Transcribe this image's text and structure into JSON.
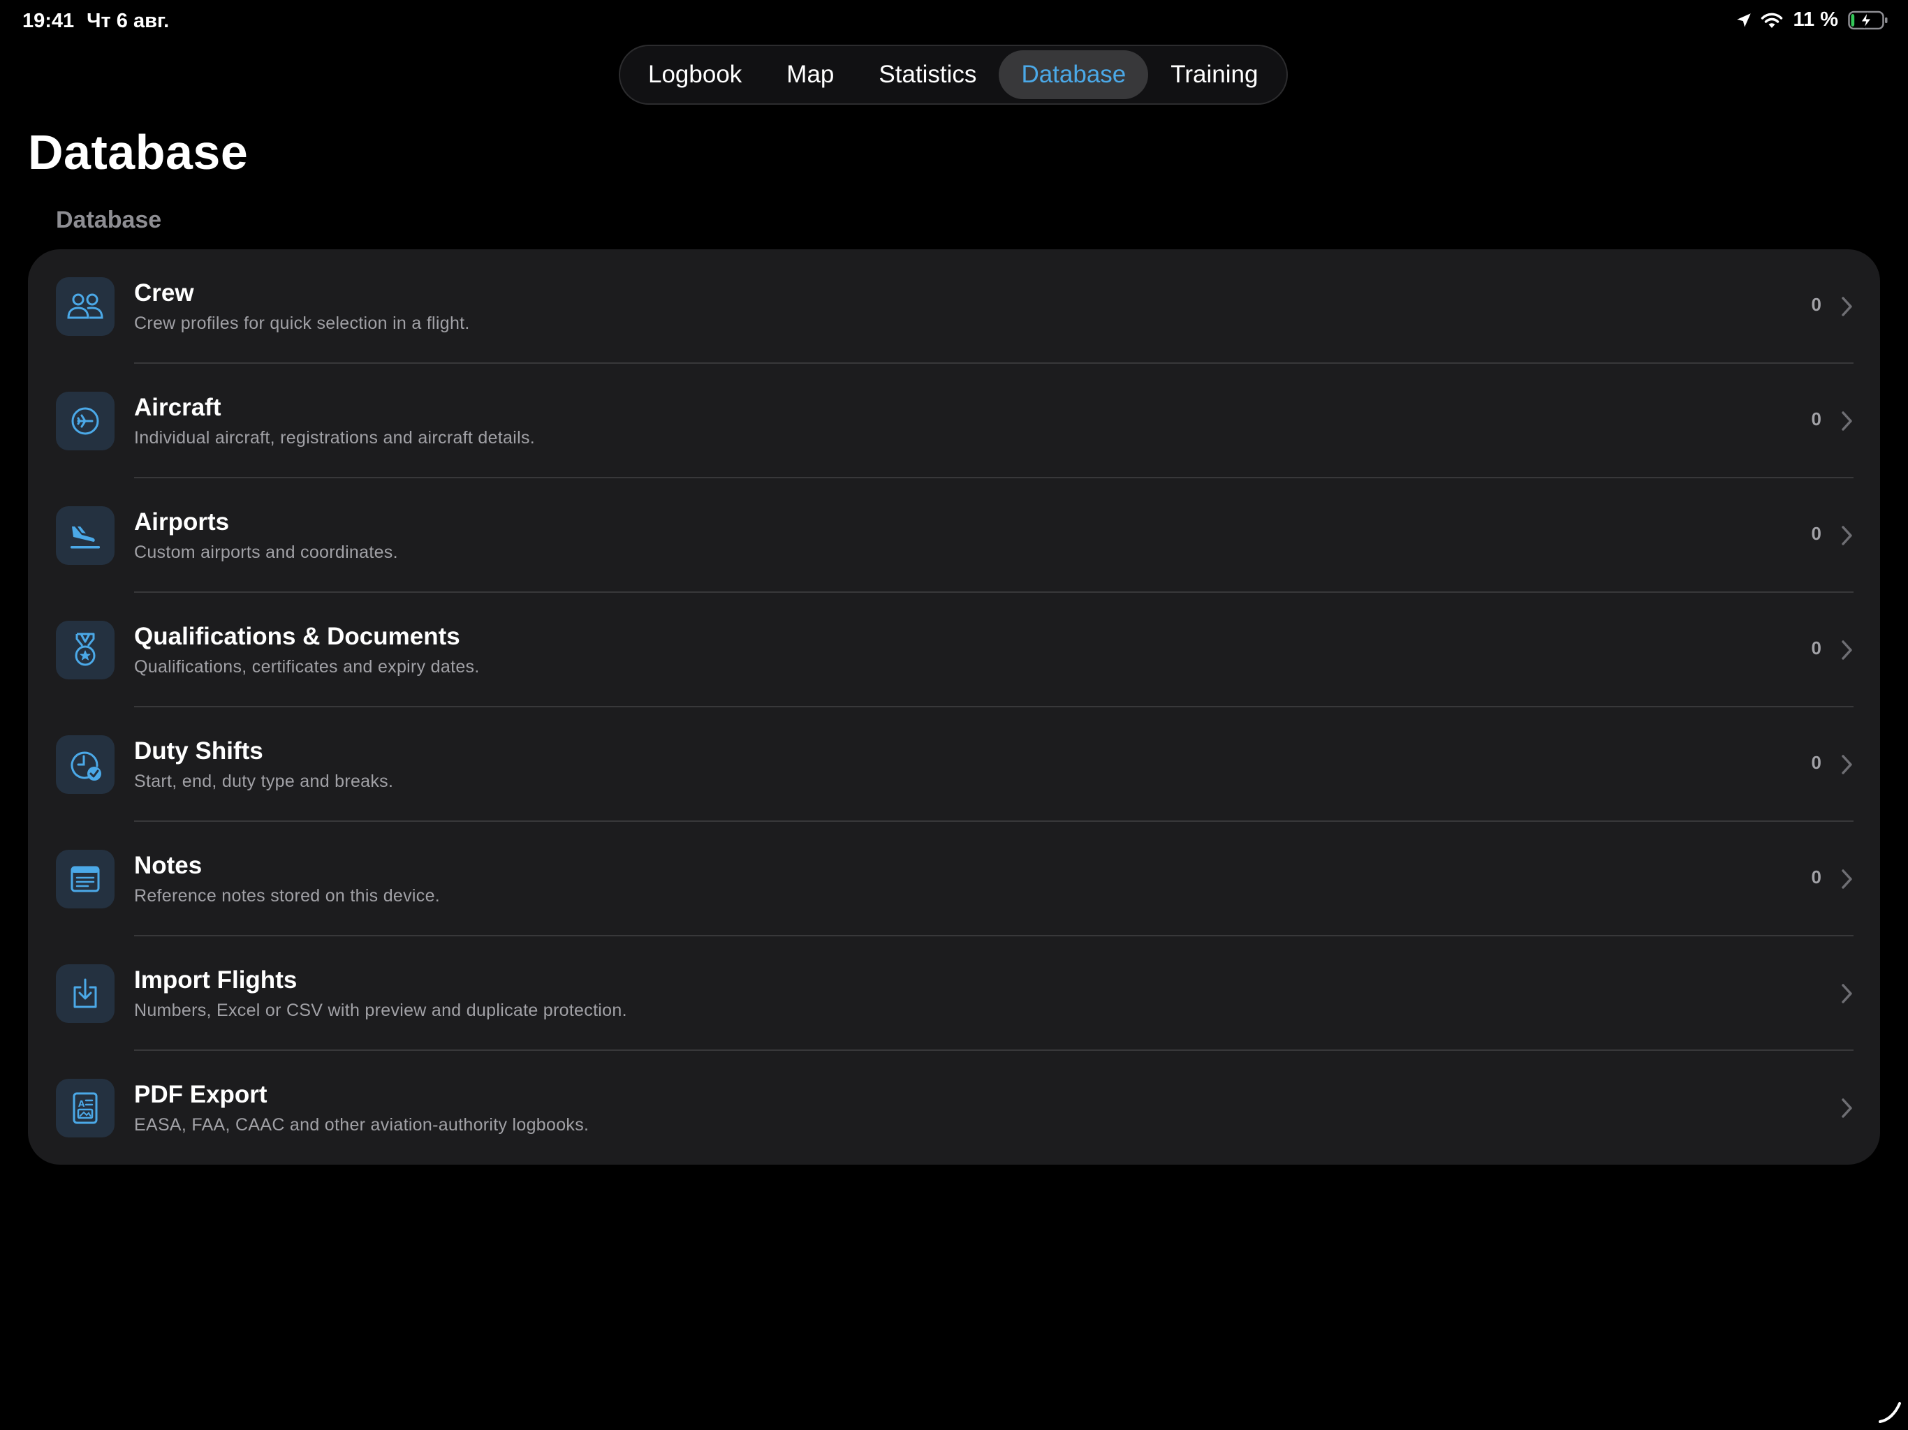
{
  "status_bar": {
    "time": "19:41",
    "date": "Чт 6 авг.",
    "battery_percent": "11 %",
    "battery_level": 0.11,
    "icons": [
      "location-arrow-icon",
      "wifi-icon",
      "battery-charging-icon"
    ]
  },
  "tabs": [
    {
      "label": "Logbook",
      "active": false
    },
    {
      "label": "Map",
      "active": false
    },
    {
      "label": "Statistics",
      "active": false
    },
    {
      "label": "Database",
      "active": true
    },
    {
      "label": "Training",
      "active": false
    }
  ],
  "page": {
    "title": "Database",
    "section_header": "Database"
  },
  "rows": [
    {
      "title": "Crew",
      "subtitle": "Crew profiles for quick selection in a flight.",
      "count": "0",
      "icon": "crew-icon"
    },
    {
      "title": "Aircraft",
      "subtitle": "Individual aircraft, registrations and aircraft details.",
      "count": "0",
      "icon": "aircraft-icon"
    },
    {
      "title": "Airports",
      "subtitle": "Custom airports and coordinates.",
      "count": "0",
      "icon": "airplane-landing-icon"
    },
    {
      "title": "Qualifications & Documents",
      "subtitle": "Qualifications, certificates and expiry dates.",
      "count": "0",
      "icon": "medal-icon"
    },
    {
      "title": "Duty Shifts",
      "subtitle": "Start, end, duty type and breaks.",
      "count": "0",
      "icon": "clock-checkmark-icon"
    },
    {
      "title": "Notes",
      "subtitle": "Reference notes stored on this device.",
      "count": "0",
      "icon": "notes-icon"
    },
    {
      "title": "Import Flights",
      "subtitle": "Numbers, Excel or CSV with preview and duplicate protection.",
      "count": "",
      "icon": "import-tray-icon"
    },
    {
      "title": "PDF Export",
      "subtitle": "EASA, FAA, CAAC and other aviation-authority logbooks.",
      "count": "",
      "icon": "pdf-document-icon"
    }
  ],
  "colors": {
    "accent": "#4ba9e8",
    "background": "#000000",
    "card": "#1c1c1e",
    "icon_tile": "#243140",
    "secondary_text": "#a1a1a6",
    "battery_charging": "#34c759"
  }
}
